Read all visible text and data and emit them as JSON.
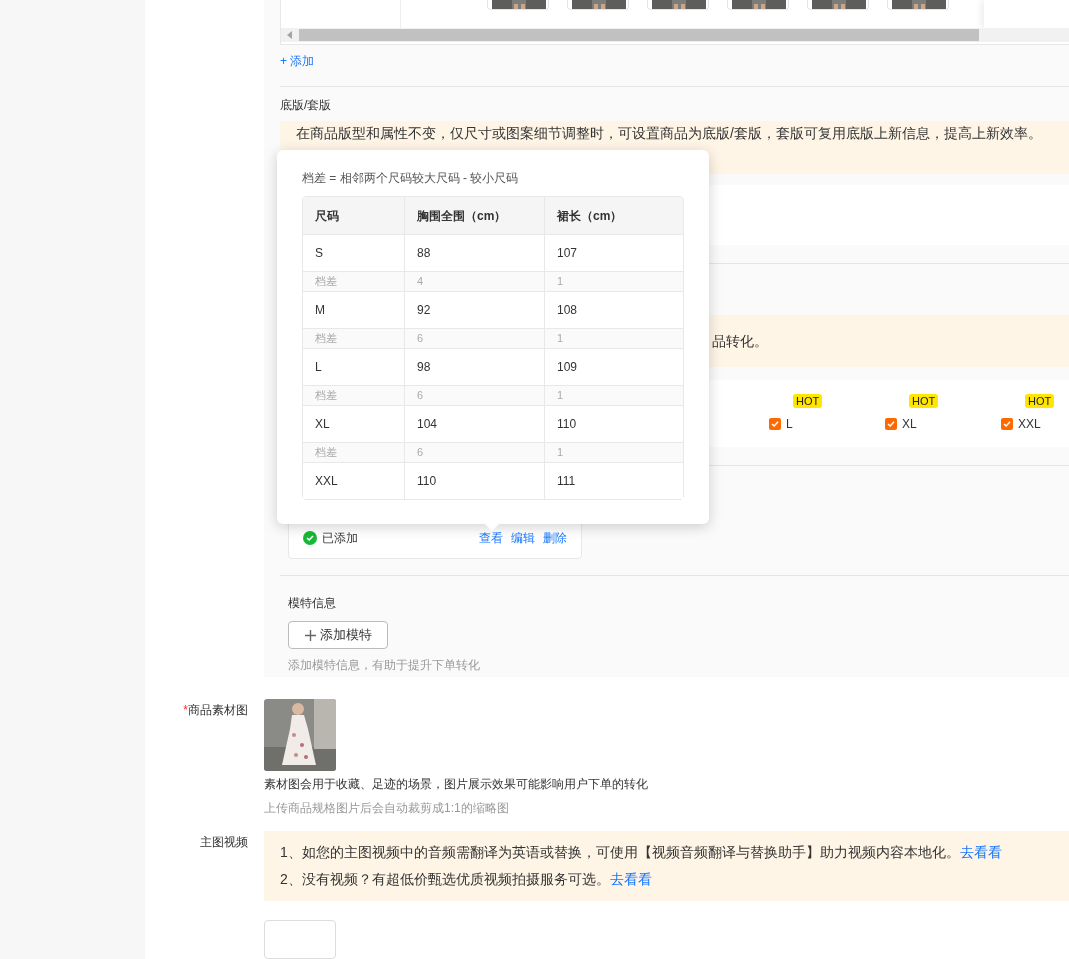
{
  "add_link": "+ 添加",
  "base_version": {
    "label": "底版/套版",
    "notice": "在商品版型和属性不变，仅尺寸或图案细节调整时，可设置商品为底版/套版，套版可复用底版上新信息，提高上新效率。"
  },
  "notice_fragment": "品转化。",
  "sizes": [
    {
      "label": "L",
      "checked": true,
      "badge": "HOT"
    },
    {
      "label": "XL",
      "checked": true,
      "badge": "HOT"
    },
    {
      "label": "XXL",
      "checked": true,
      "badge": "HOT"
    }
  ],
  "size_chart_card": {
    "status": "已添加",
    "actions": [
      "查看",
      "编辑",
      "删除"
    ]
  },
  "model_info": {
    "label": "模特信息",
    "button": "添加模特",
    "hint": "添加模特信息，有助于提升下单转化"
  },
  "popover": {
    "note": "档差 = 相邻两个尺码较大尺码 - 较小尺码",
    "columns": [
      "尺码",
      "胸围全围（cm）",
      "裙长（cm）"
    ],
    "rows": [
      {
        "kind": "size",
        "cells": [
          "S",
          "88",
          "107"
        ]
      },
      {
        "kind": "diff",
        "cells": [
          "档差",
          "4",
          "1"
        ]
      },
      {
        "kind": "size",
        "cells": [
          "M",
          "92",
          "108"
        ]
      },
      {
        "kind": "diff",
        "cells": [
          "档差",
          "6",
          "1"
        ]
      },
      {
        "kind": "size",
        "cells": [
          "L",
          "98",
          "109"
        ]
      },
      {
        "kind": "diff",
        "cells": [
          "档差",
          "6",
          "1"
        ]
      },
      {
        "kind": "size",
        "cells": [
          "XL",
          "104",
          "110"
        ]
      },
      {
        "kind": "diff",
        "cells": [
          "档差",
          "6",
          "1"
        ]
      },
      {
        "kind": "size",
        "cells": [
          "XXL",
          "110",
          "111"
        ]
      }
    ]
  },
  "material_image": {
    "label": "商品素材图",
    "required_mark": "*",
    "note": "素材图会用于收藏、足迹的场景，图片展示效果可能影响用户下单的转化",
    "hint": "上传商品规格图片后会自动裁剪成1:1的缩略图"
  },
  "main_video": {
    "label": "主图视频",
    "tips": [
      {
        "text": "1、如您的主图视频中的音频需翻译为英语或替换，可使用【视频音频翻译与替换助手】助力视频内容本地化。",
        "link": "去看看"
      },
      {
        "text": "2、没有视频？有超低价甄选优质视频拍摄服务可选。",
        "link": "去看看"
      }
    ]
  }
}
